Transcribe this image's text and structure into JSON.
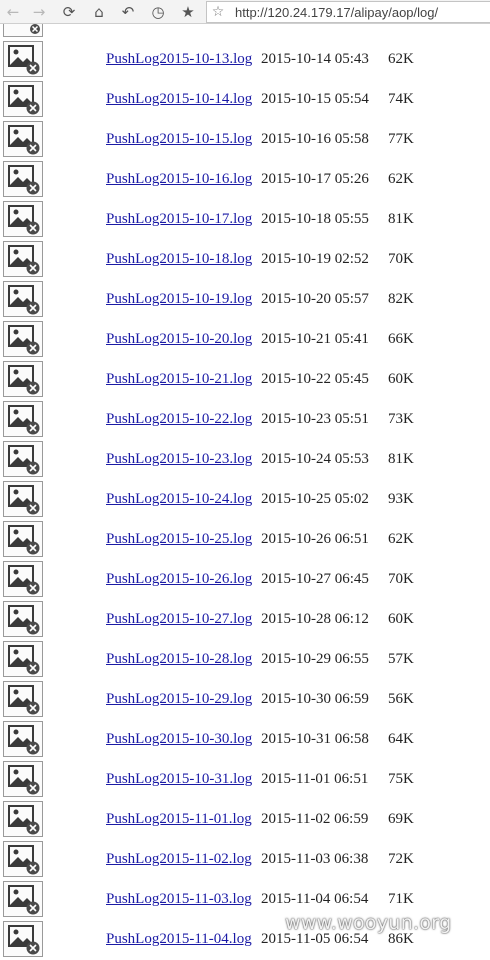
{
  "toolbar": {
    "url": "http://120.24.179.17/alipay/aop/log/"
  },
  "files": [
    {
      "name": "PushLog2015-10-13.log",
      "date": "2015-10-14 05:43",
      "size": "62K"
    },
    {
      "name": "PushLog2015-10-14.log",
      "date": "2015-10-15 05:54",
      "size": "74K"
    },
    {
      "name": "PushLog2015-10-15.log",
      "date": "2015-10-16 05:58",
      "size": "77K"
    },
    {
      "name": "PushLog2015-10-16.log",
      "date": "2015-10-17 05:26",
      "size": "62K"
    },
    {
      "name": "PushLog2015-10-17.log",
      "date": "2015-10-18 05:55",
      "size": "81K"
    },
    {
      "name": "PushLog2015-10-18.log",
      "date": "2015-10-19 02:52",
      "size": "70K"
    },
    {
      "name": "PushLog2015-10-19.log",
      "date": "2015-10-20 05:57",
      "size": "82K"
    },
    {
      "name": "PushLog2015-10-20.log",
      "date": "2015-10-21 05:41",
      "size": "66K"
    },
    {
      "name": "PushLog2015-10-21.log",
      "date": "2015-10-22 05:45",
      "size": "60K"
    },
    {
      "name": "PushLog2015-10-22.log",
      "date": "2015-10-23 05:51",
      "size": "73K"
    },
    {
      "name": "PushLog2015-10-23.log",
      "date": "2015-10-24 05:53",
      "size": "81K"
    },
    {
      "name": "PushLog2015-10-24.log",
      "date": "2015-10-25 05:02",
      "size": "93K"
    },
    {
      "name": "PushLog2015-10-25.log",
      "date": "2015-10-26 06:51",
      "size": "62K"
    },
    {
      "name": "PushLog2015-10-26.log",
      "date": "2015-10-27 06:45",
      "size": "70K"
    },
    {
      "name": "PushLog2015-10-27.log",
      "date": "2015-10-28 06:12",
      "size": "60K"
    },
    {
      "name": "PushLog2015-10-28.log",
      "date": "2015-10-29 06:55",
      "size": "57K"
    },
    {
      "name": "PushLog2015-10-29.log",
      "date": "2015-10-30 06:59",
      "size": "56K"
    },
    {
      "name": "PushLog2015-10-30.log",
      "date": "2015-10-31 06:58",
      "size": "64K"
    },
    {
      "name": "PushLog2015-10-31.log",
      "date": "2015-11-01 06:51",
      "size": "75K"
    },
    {
      "name": "PushLog2015-11-01.log",
      "date": "2015-11-02 06:59",
      "size": "69K"
    },
    {
      "name": "PushLog2015-11-02.log",
      "date": "2015-11-03 06:38",
      "size": "72K"
    },
    {
      "name": "PushLog2015-11-03.log",
      "date": "2015-11-04 06:54",
      "size": "71K"
    },
    {
      "name": "PushLog2015-11-04.log",
      "date": "2015-11-05 06:54",
      "size": "86K"
    }
  ],
  "watermark": "www.wooyun.org"
}
